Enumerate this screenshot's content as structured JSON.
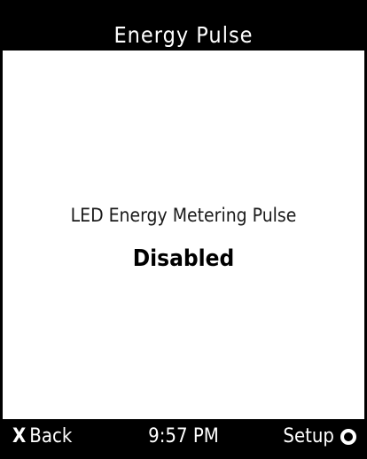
{
  "header": {
    "title": "Energy Pulse"
  },
  "main": {
    "setting_label": "LED Energy Metering Pulse",
    "setting_value": "Disabled"
  },
  "footer": {
    "back_icon": "X",
    "back_label": "Back",
    "time": "9:57 PM",
    "setup_label": "Setup",
    "setup_icon": "circle-icon"
  },
  "colors": {
    "background": "#ffffff",
    "bars": "#000000",
    "bar_text": "#ffffff"
  }
}
